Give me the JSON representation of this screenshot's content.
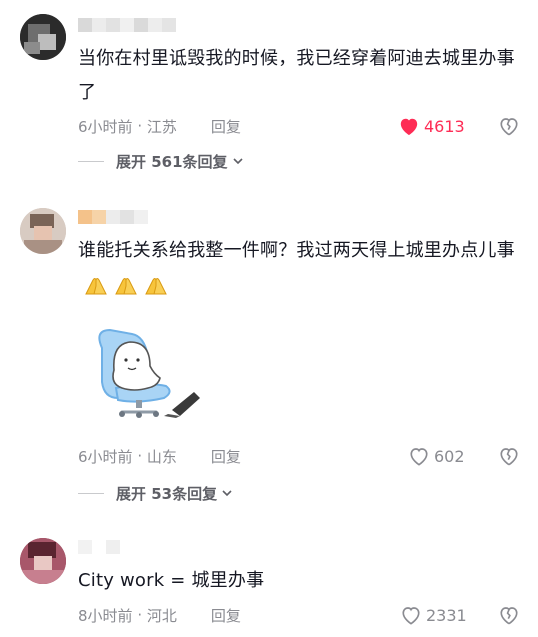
{
  "comments": [
    {
      "text": "当你在村里诋毁我的时候，我已经穿着阿迪去城里办事了",
      "time": "6小时前",
      "location": "江苏",
      "reply_label": "回复",
      "likes": "4613",
      "liked": true,
      "expand_label": "展开 561条回复"
    },
    {
      "text": "谁能托关系给我整一件啊？我过两天得上城里办点儿事",
      "emoji": [
        "hands-emoji",
        "hands-emoji",
        "hands-emoji"
      ],
      "time": "6小时前",
      "location": "山东",
      "reply_label": "回复",
      "likes": "602",
      "liked": false,
      "expand_label": "展开 53条回复",
      "sticker": "cute-ghost-sitting-chair-laptop-sticker"
    },
    {
      "text": "City work = 城里办事",
      "time": "8小时前",
      "location": "河北",
      "reply_label": "回复",
      "likes": "2331",
      "liked": false
    }
  ],
  "colors": {
    "like_active": "#fe2c55",
    "meta_gray": "#8a8b91",
    "text": "#161823"
  }
}
